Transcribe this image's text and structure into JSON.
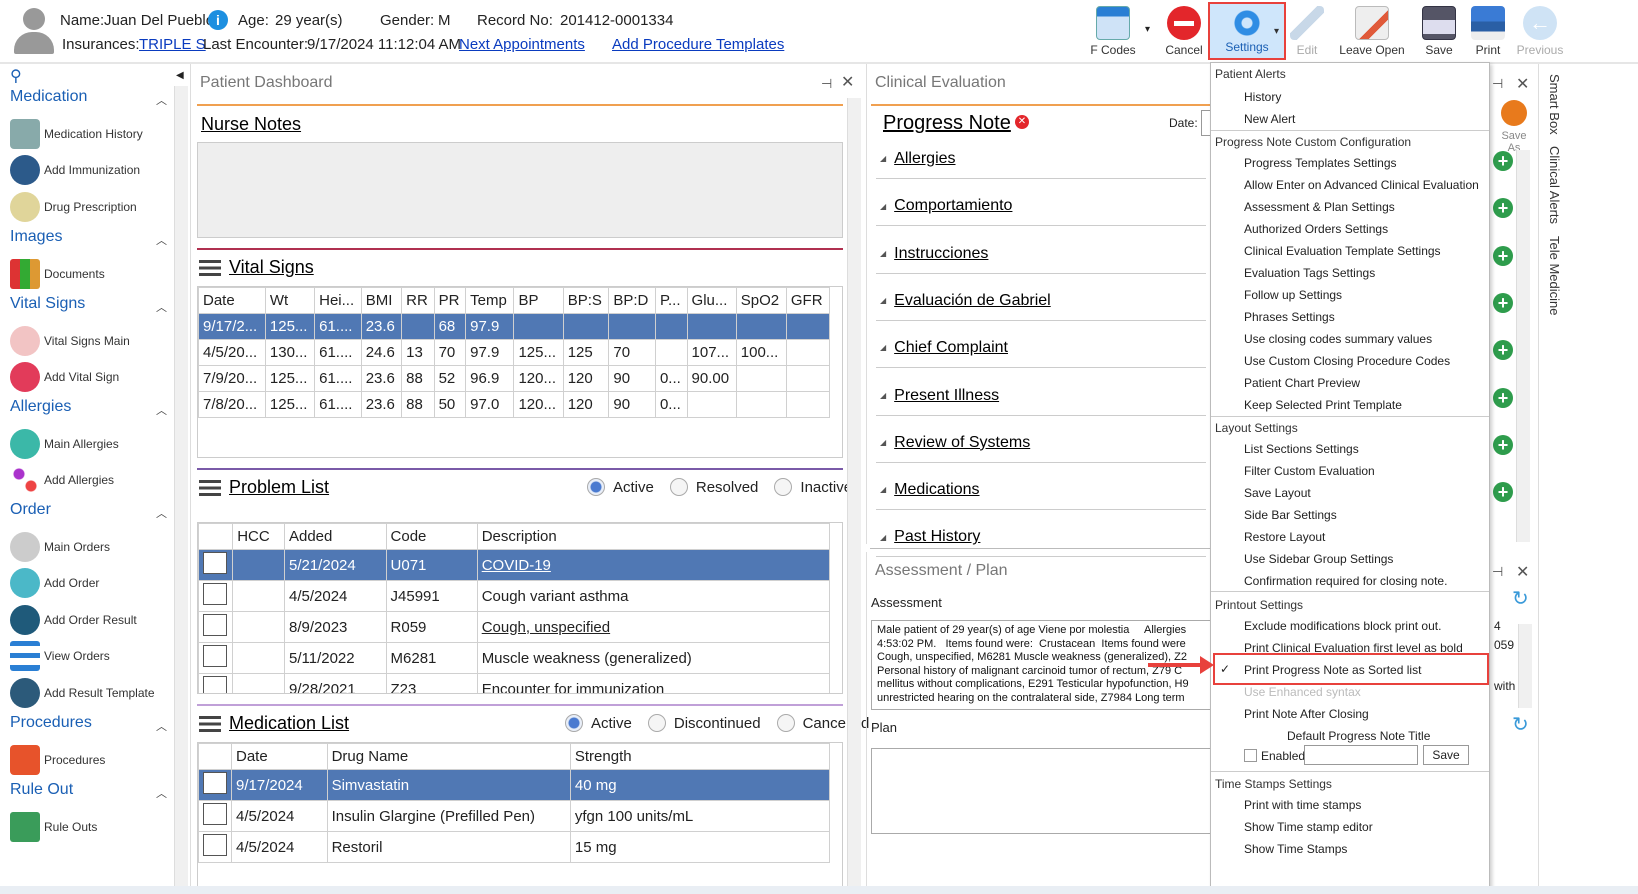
{
  "header": {
    "name_label": "Name:",
    "name": "Juan Del Pueblo",
    "age_label": "Age:",
    "age": "29 year(s)",
    "gender_label": "Gender:",
    "gender": "M",
    "record_label": "Record No:",
    "record": "201412-0001334",
    "ins_label": "Insurances:",
    "ins": "TRIPLE S",
    "last_label": "Last Encounter:",
    "last": "9/17/2024 11:12:04 AM",
    "next_appt": "Next Appointments",
    "add_proc": "Add Procedure Templates"
  },
  "toolbar": {
    "fcodes": "F Codes",
    "cancel": "Cancel",
    "settings": "Settings",
    "edit": "Edit",
    "leave_open": "Leave Open",
    "save": "Save",
    "print": "Print",
    "previous": "Previous"
  },
  "sidebar": {
    "medication": "Medication",
    "med_history": "Medication History",
    "add_immun": "Add Immunization",
    "drug_rx": "Drug Prescription",
    "images": "Images",
    "documents": "Documents",
    "vital_signs": "Vital Signs",
    "vs_main": "Vital Signs Main",
    "add_vs": "Add Vital Sign",
    "allergies": "Allergies",
    "main_allergies": "Main Allergies",
    "add_allergies": "Add Allergies",
    "order": "Order",
    "main_orders": "Main Orders",
    "add_order": "Add Order",
    "add_order_result": "Add Order Result",
    "view_orders": "View Orders",
    "add_result_tpl": "Add Result Template",
    "procedures": "Procedures",
    "procedures_item": "Procedures",
    "rule_out": "Rule Out",
    "rule_outs": "Rule Outs"
  },
  "dashboard": {
    "title": "Patient Dashboard",
    "nurse_notes": "Nurse Notes",
    "vital_signs": "Vital Signs",
    "vs_cols": [
      "Date",
      "Wt",
      "Hei...",
      "BMI",
      "RR",
      "PR",
      "Temp",
      "BP",
      "BP:S",
      "BP:D",
      "P...",
      "Glu...",
      "SpO2",
      "GFR"
    ],
    "vs_rows": [
      [
        "9/17/2...",
        "125...",
        "61....",
        "23.6",
        "",
        "68",
        "97.9",
        "",
        "",
        "",
        "",
        "",
        "",
        ""
      ],
      [
        "4/5/20...",
        "130...",
        "61....",
        "24.6",
        "13",
        "70",
        "97.9",
        "125...",
        "125",
        "70",
        "",
        "107...",
        "100...",
        ""
      ],
      [
        "7/9/20...",
        "125...",
        "61....",
        "23.6",
        "88",
        "52",
        "96.9",
        "120...",
        "120",
        "90",
        "0...",
        "90.00",
        "",
        ""
      ],
      [
        "7/8/20...",
        "125...",
        "61....",
        "23.6",
        "88",
        "50",
        "97.0",
        "120...",
        "120",
        "90",
        "0...",
        "",
        "",
        ""
      ]
    ],
    "problem_list": "Problem List",
    "pl_active": "Active",
    "pl_resolved": "Resolved",
    "pl_inactive": "Inactive",
    "pl_cols": [
      "HCC",
      "Added",
      "Code",
      "Description"
    ],
    "pl_rows": [
      [
        "",
        "5/21/2024",
        "U071",
        "COVID-19"
      ],
      [
        "",
        "4/5/2024",
        "J45991",
        "Cough variant asthma"
      ],
      [
        "",
        "8/9/2023",
        "R059",
        "Cough, unspecified"
      ],
      [
        "",
        "5/11/2022",
        "M6281",
        "Muscle weakness (generalized)"
      ],
      [
        "",
        "9/28/2021",
        "Z23",
        "Encounter for immunization"
      ]
    ],
    "medication_list": "Medication List",
    "ml_active": "Active",
    "ml_discontinued": "Discontinued",
    "ml_cancelled": "Cancelled",
    "ml_cols": [
      "Date",
      "Drug Name",
      "Strength"
    ],
    "ml_rows": [
      [
        "9/17/2024",
        "Simvastatin",
        "40 mg"
      ],
      [
        "4/5/2024",
        "Insulin Glargine (Prefilled Pen)",
        "yfgn 100 units/mL"
      ],
      [
        "4/5/2024",
        "Restoril",
        "15 mg"
      ]
    ]
  },
  "clinical": {
    "title": "Clinical Evaluation",
    "progress_note": "Progress Note",
    "date_label": "Date:",
    "sections": [
      "Allergies",
      "Comportamiento",
      "Instrucciones",
      "Evaluación de Gabriel",
      "Chief Complaint",
      "Present Illness",
      "Review of Systems",
      "Medications",
      "Past History"
    ],
    "save_as": "Save As"
  },
  "assessment": {
    "title": "Assessment / Plan",
    "assessment_label": "Assessment",
    "plan_label": "Plan",
    "text": "Male patient of 29 year(s) of age Viene por molestia     Allergies\n4:53:02 PM.   Items found were:  Crustacean  Items found were\nCough, unspecified, M6281 Muscle weakness (generalized), Z2\nPersonal history of malignant carcinoid tumor of rectum, Z79 C\nmellitus without complications, E291 Testicular hypofunction, H9\nunrestricted hearing on the contralateral side, Z7984 Long term",
    "side_a": "4",
    "side_b": "059",
    "side_c": "with"
  },
  "menu": {
    "g_alerts": "Patient Alerts",
    "history": "History",
    "new_alert": "New Alert",
    "g_pn": "Progress Note Custom Configuration",
    "pn_items": [
      "Progress Templates Settings",
      "Allow Enter on Advanced Clinical Evaluation",
      "Assessment & Plan Settings",
      "Authorized Orders Settings",
      "Clinical Evaluation Template Settings",
      "Evaluation Tags Settings",
      "Follow up Settings",
      "Phrases Settings",
      "Use closing codes summary values",
      "Use Custom Closing Procedure Codes",
      "Patient Chart Preview",
      "Keep Selected Print Template"
    ],
    "g_layout": "Layout Settings",
    "layout_items": [
      "List Sections Settings",
      "Filter Custom Evaluation",
      "Save Layout",
      "Side Bar Settings",
      "Restore Layout",
      "Use Sidebar Group Settings",
      "Confirmation required for closing note."
    ],
    "g_print": "Printout Settings",
    "print_items": [
      "Exclude modifications block print out.",
      "Print Clinical Evaluation first level as bold"
    ],
    "sorted": "Print Progress Note as Sorted list",
    "checkmark": "✓",
    "enhanced": "Use Enhanced syntax",
    "after_closing": "Print Note After Closing",
    "default_title": "Default Progress Note Title",
    "enabled": "Enabled",
    "save": "Save",
    "g_time": "Time Stamps Settings",
    "time_items": [
      "Print with time stamps",
      "Show Time stamp editor",
      "Show Time Stamps"
    ]
  },
  "right_tabs": [
    "Smart Box",
    "Clinical Alerts",
    "Tele Medicine"
  ],
  "colors": {
    "accent": "#1a5fb4",
    "highlight": "#e8413c",
    "selected_row": "#5078b4"
  }
}
